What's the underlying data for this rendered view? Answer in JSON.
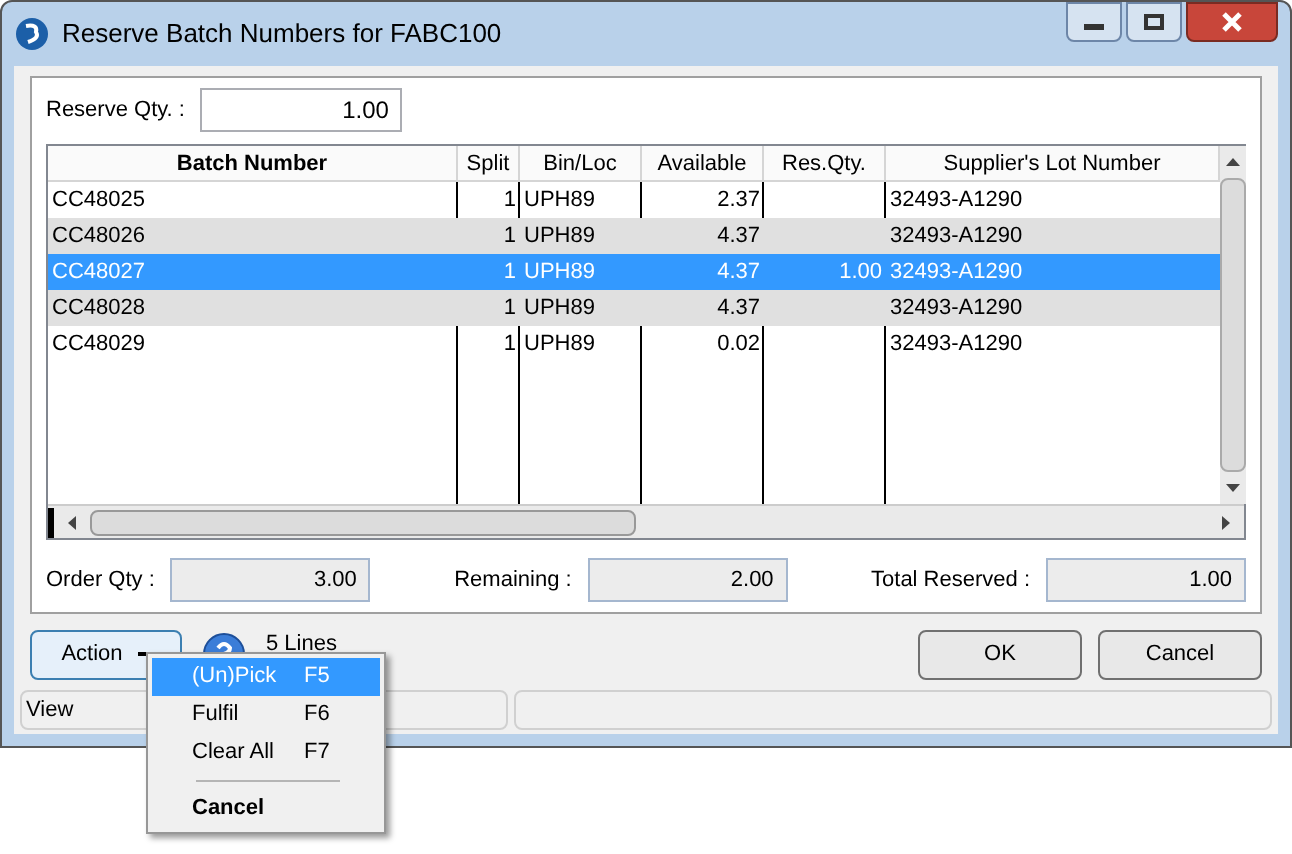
{
  "window": {
    "title": "Reserve Batch Numbers for FABC100"
  },
  "reserve_qty": {
    "label": "Reserve Qty. :",
    "value": "1.00"
  },
  "table": {
    "columns": [
      "Batch Number",
      "Split",
      "Bin/Loc",
      "Available",
      "Res.Qty.",
      "Supplier's Lot Number"
    ],
    "rows": [
      {
        "cells": [
          "CC48025",
          "1",
          "UPH89",
          "2.37",
          "",
          "32493-A1290"
        ],
        "selected": false
      },
      {
        "cells": [
          "CC48026",
          "1",
          "UPH89",
          "4.37",
          "",
          "32493-A1290"
        ],
        "selected": false
      },
      {
        "cells": [
          "CC48027",
          "1",
          "UPH89",
          "4.37",
          "1.00",
          "32493-A1290"
        ],
        "selected": true
      },
      {
        "cells": [
          "CC48028",
          "1",
          "UPH89",
          "4.37",
          "",
          "32493-A1290"
        ],
        "selected": false
      },
      {
        "cells": [
          "CC48029",
          "1",
          "UPH89",
          "0.02",
          "",
          "32493-A1290"
        ],
        "selected": false
      }
    ]
  },
  "totals": [
    {
      "label": "Order Qty :",
      "value": "3.00"
    },
    {
      "label": "Remaining :",
      "value": "2.00"
    },
    {
      "label": "Total Reserved :",
      "value": "1.00"
    }
  ],
  "action_button": {
    "label": "Action"
  },
  "lines_label": "5 Lines",
  "buttons": [
    "OK",
    "Cancel"
  ],
  "status_bar": {
    "text": "View"
  },
  "menu": {
    "items": [
      {
        "kind": "item",
        "label": "(Un)Pick",
        "shortcut": "F5",
        "selected": true
      },
      {
        "kind": "item",
        "label": "Fulfil",
        "shortcut": "F6",
        "selected": false
      },
      {
        "kind": "item",
        "label": "Clear All",
        "shortcut": "F7",
        "selected": false
      },
      {
        "kind": "separator"
      },
      {
        "kind": "bold",
        "label": "Cancel",
        "selected": false
      }
    ]
  }
}
